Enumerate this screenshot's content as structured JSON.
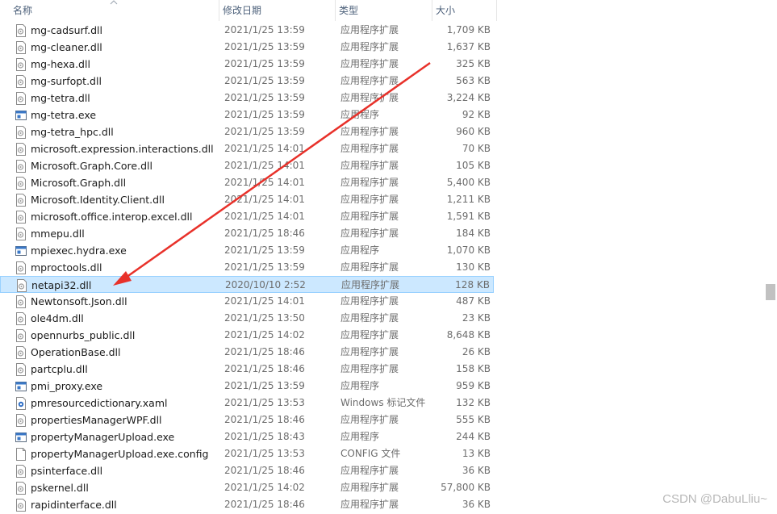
{
  "columns": {
    "name": "名称",
    "date": "修改日期",
    "type": "类型",
    "size": "大小"
  },
  "files": [
    {
      "name": "mg-cadsurf.dll",
      "date": "2021/1/25 13:59",
      "type": "应用程序扩展",
      "size": "1,709 KB",
      "icon": "dll-icon"
    },
    {
      "name": "mg-cleaner.dll",
      "date": "2021/1/25 13:59",
      "type": "应用程序扩展",
      "size": "1,637 KB",
      "icon": "dll-icon"
    },
    {
      "name": "mg-hexa.dll",
      "date": "2021/1/25 13:59",
      "type": "应用程序扩展",
      "size": "325 KB",
      "icon": "dll-icon"
    },
    {
      "name": "mg-surfopt.dll",
      "date": "2021/1/25 13:59",
      "type": "应用程序扩展",
      "size": "563 KB",
      "icon": "dll-icon"
    },
    {
      "name": "mg-tetra.dll",
      "date": "2021/1/25 13:59",
      "type": "应用程序扩展",
      "size": "3,224 KB",
      "icon": "dll-icon"
    },
    {
      "name": "mg-tetra.exe",
      "date": "2021/1/25 13:59",
      "type": "应用程序",
      "size": "92 KB",
      "icon": "exe-icon"
    },
    {
      "name": "mg-tetra_hpc.dll",
      "date": "2021/1/25 13:59",
      "type": "应用程序扩展",
      "size": "960 KB",
      "icon": "dll-icon"
    },
    {
      "name": "microsoft.expression.interactions.dll",
      "date": "2021/1/25 14:01",
      "type": "应用程序扩展",
      "size": "70 KB",
      "icon": "dll-icon"
    },
    {
      "name": "Microsoft.Graph.Core.dll",
      "date": "2021/1/25 14:01",
      "type": "应用程序扩展",
      "size": "105 KB",
      "icon": "dll-icon"
    },
    {
      "name": "Microsoft.Graph.dll",
      "date": "2021/1/25 14:01",
      "type": "应用程序扩展",
      "size": "5,400 KB",
      "icon": "dll-icon"
    },
    {
      "name": "Microsoft.Identity.Client.dll",
      "date": "2021/1/25 14:01",
      "type": "应用程序扩展",
      "size": "1,211 KB",
      "icon": "dll-icon"
    },
    {
      "name": "microsoft.office.interop.excel.dll",
      "date": "2021/1/25 14:01",
      "type": "应用程序扩展",
      "size": "1,591 KB",
      "icon": "dll-icon"
    },
    {
      "name": "mmepu.dll",
      "date": "2021/1/25 18:46",
      "type": "应用程序扩展",
      "size": "184 KB",
      "icon": "dll-icon"
    },
    {
      "name": "mpiexec.hydra.exe",
      "date": "2021/1/25 13:59",
      "type": "应用程序",
      "size": "1,070 KB",
      "icon": "exe-icon"
    },
    {
      "name": "mproctools.dll",
      "date": "2021/1/25 13:59",
      "type": "应用程序扩展",
      "size": "130 KB",
      "icon": "dll-icon"
    },
    {
      "name": "netapi32.dll",
      "date": "2020/10/10 2:52",
      "type": "应用程序扩展",
      "size": "128 KB",
      "icon": "dll-icon",
      "selected": true
    },
    {
      "name": "Newtonsoft.Json.dll",
      "date": "2021/1/25 14:01",
      "type": "应用程序扩展",
      "size": "487 KB",
      "icon": "dll-icon"
    },
    {
      "name": "ole4dm.dll",
      "date": "2021/1/25 13:50",
      "type": "应用程序扩展",
      "size": "23 KB",
      "icon": "dll-icon"
    },
    {
      "name": "opennurbs_public.dll",
      "date": "2021/1/25 14:02",
      "type": "应用程序扩展",
      "size": "8,648 KB",
      "icon": "dll-icon"
    },
    {
      "name": "OperationBase.dll",
      "date": "2021/1/25 18:46",
      "type": "应用程序扩展",
      "size": "26 KB",
      "icon": "dll-icon"
    },
    {
      "name": "partcplu.dll",
      "date": "2021/1/25 18:46",
      "type": "应用程序扩展",
      "size": "158 KB",
      "icon": "dll-icon"
    },
    {
      "name": "pmi_proxy.exe",
      "date": "2021/1/25 13:59",
      "type": "应用程序",
      "size": "959 KB",
      "icon": "exe-icon"
    },
    {
      "name": "pmresourcedictionary.xaml",
      "date": "2021/1/25 13:53",
      "type": "Windows 标记文件",
      "size": "132 KB",
      "icon": "xaml-icon"
    },
    {
      "name": "propertiesManagerWPF.dll",
      "date": "2021/1/25 18:46",
      "type": "应用程序扩展",
      "size": "555 KB",
      "icon": "dll-icon"
    },
    {
      "name": "propertyManagerUpload.exe",
      "date": "2021/1/25 18:43",
      "type": "应用程序",
      "size": "244 KB",
      "icon": "exe-icon"
    },
    {
      "name": "propertyManagerUpload.exe.config",
      "date": "2021/1/25 13:53",
      "type": "CONFIG 文件",
      "size": "13 KB",
      "icon": "file-icon"
    },
    {
      "name": "psinterface.dll",
      "date": "2021/1/25 18:46",
      "type": "应用程序扩展",
      "size": "36 KB",
      "icon": "dll-icon"
    },
    {
      "name": "pskernel.dll",
      "date": "2021/1/25 14:02",
      "type": "应用程序扩展",
      "size": "57,800 KB",
      "icon": "dll-icon"
    },
    {
      "name": "rapidinterface.dll",
      "date": "2021/1/25 18:46",
      "type": "应用程序扩展",
      "size": "36 KB",
      "icon": "dll-icon"
    }
  ],
  "watermark": "CSDN @DabuLliu~",
  "colors": {
    "selection_bg": "#cce8ff",
    "selection_border": "#99d1ff",
    "arrow": "#e8312a",
    "header_text": "#4c607a"
  }
}
